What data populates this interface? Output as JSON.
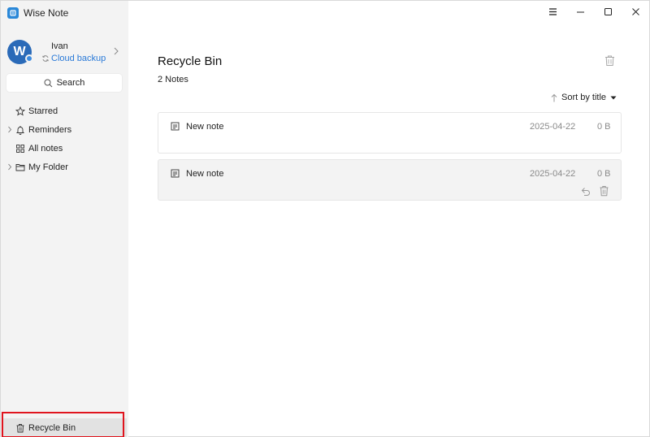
{
  "app": {
    "title": "Wise Note"
  },
  "profile": {
    "avatar_letter": "W",
    "name": "Ivan",
    "cloud_label": "Cloud backup"
  },
  "search": {
    "label": "Search"
  },
  "sidebar": {
    "items": [
      {
        "label": "Starred",
        "icon": "star-icon"
      },
      {
        "label": "Reminders",
        "icon": "bell-icon"
      },
      {
        "label": "All notes",
        "icon": "grid-icon"
      },
      {
        "label": "My Folder",
        "icon": "folder-icon"
      }
    ],
    "recycle_label": "Recycle Bin"
  },
  "main": {
    "title": "Recycle Bin",
    "count": "2 Notes",
    "sort_label": "Sort by title"
  },
  "notes": [
    {
      "title": "New note",
      "date": "2025-04-22",
      "size": "0 B"
    },
    {
      "title": "New note",
      "date": "2025-04-22",
      "size": "0 B"
    }
  ],
  "colors": {
    "accent": "#2a7ad8",
    "highlight": "#e0141e",
    "sidebar_bg": "#f3f3f3"
  }
}
